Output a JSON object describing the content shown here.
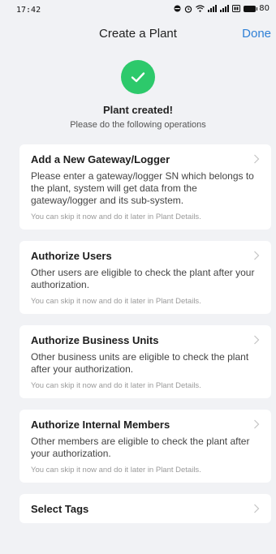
{
  "status_bar": {
    "time": "17:42",
    "battery": "80"
  },
  "header": {
    "title": "Create a Plant",
    "done_label": "Done"
  },
  "hero": {
    "icon": "check-icon",
    "title": "Plant created!",
    "subtitle": "Please do the following operations"
  },
  "cards": [
    {
      "title": "Add a New Gateway/Logger",
      "description": "Please enter a gateway/logger SN which belongs to the plant, system will get data from the gateway/logger and its sub-system.",
      "hint": "You can skip it now and do it later in Plant Details."
    },
    {
      "title": "Authorize Users",
      "description": "Other users are eligible to check the plant after your authorization.",
      "hint": "You can skip it now and do it later in Plant Details."
    },
    {
      "title": "Authorize Business Units",
      "description": "Other business units are eligible to check the plant after your authorization.",
      "hint": "You can skip it now and do it later in Plant Details."
    },
    {
      "title": "Authorize Internal Members",
      "description": "Other members are eligible to check the plant after your authorization.",
      "hint": "You can skip it now and do it later in Plant Details."
    },
    {
      "title": "Select Tags",
      "description": "",
      "hint": ""
    }
  ],
  "colors": {
    "accent": "#2f80d6",
    "success": "#2dc96b",
    "background": "#f1f2f5"
  }
}
